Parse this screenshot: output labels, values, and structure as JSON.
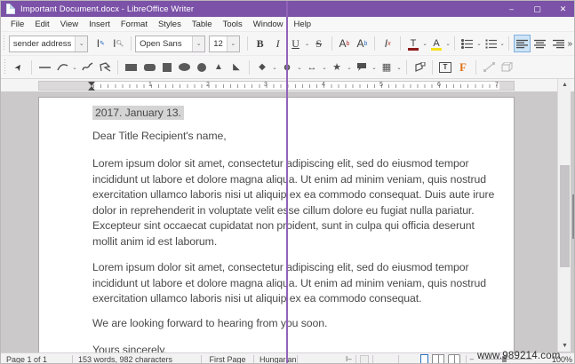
{
  "window": {
    "title": "Important Document.docx - LibreOffice Writer",
    "controls": {
      "minimize": "–",
      "maximize": "▢",
      "close": "✕"
    }
  },
  "menubar": {
    "items": [
      "File",
      "Edit",
      "View",
      "Insert",
      "Format",
      "Styles",
      "Table",
      "Tools",
      "Window",
      "Help"
    ]
  },
  "format_toolbar": {
    "paragraph_style": "sender address",
    "font_name": "Open Sans",
    "font_size": "12",
    "bold": "B",
    "italic": "I",
    "underline": "U",
    "strikethrough": "S",
    "superscript_base": "A",
    "superscript_mark": "b",
    "subscript_base": "A",
    "subscript_mark": "b",
    "clear_formatting": "I",
    "clear_mark": "x",
    "font_color_letter": "T",
    "highlight_letter": "A",
    "dropdown_glyph": "⌄",
    "overflow_glyph": "»"
  },
  "draw_toolbar": {
    "select_glyph": "➤",
    "triangle_glyph": "▲",
    "right_triangle_glyph": "◣",
    "diamond_glyph": "◆",
    "smiley_glyph": "☻",
    "block_arrow_glyph": "↔",
    "star_glyph": "★",
    "flowchart_glyph": "▦",
    "textbox_letter": "T",
    "fontwork_letter": "F",
    "dropdown_glyph": "⌄"
  },
  "ruler": {
    "numbers": [
      "1",
      "2",
      "3",
      "4",
      "5",
      "6",
      "7"
    ]
  },
  "document": {
    "date_field": "2017. January 13.",
    "salutation": "Dear Title Recipient's name,",
    "p1_lines": [
      "Lorem ipsum dolor sit amet, consectetur adipiscing elit, sed do eiusmod tempor",
      "incididunt ut labore et dolore magna aliqua. Ut enim ad minim veniam, quis nostrud",
      "exercitation ullamco laboris nisi ut aliquip ex ea commodo consequat. Duis aute irure",
      "dolor in reprehenderit in voluptate velit esse cillum dolore eu fugiat nulla pariatur.",
      "Excepteur sint occaecat cupidatat non proident, sunt in culpa qui officia deserunt",
      "mollit anim id est laborum."
    ],
    "p2_lines": [
      "Lorem ipsum dolor sit amet, consectetur adipiscing elit, sed do eiusmod tempor",
      "incididunt ut labore et dolore magna aliqua. Ut enim ad minim veniam, quis nostrud",
      "exercitation ullamco laboris nisi ut aliquip ex ea commodo consequat."
    ],
    "closing_line": "We are looking forward to hearing from you soon.",
    "signoff": "Yours sincerely,"
  },
  "statusbar": {
    "page_info": "Page 1 of 1",
    "word_count": "153 words, 982 characters",
    "page_style": "First Page",
    "language": "Hungarian",
    "insert_mode_glyph": "I–",
    "zoom_minus": "–",
    "zoom_level": "100%"
  },
  "scrollbar": {
    "up_glyph": "▲",
    "down_glyph": "▼"
  },
  "watermark": "www.989214.com",
  "colors": {
    "titlebar": "#7b52a7",
    "divider_line": "#9263b8",
    "selected_tool_bg": "#cde4f7",
    "font_color_bar": "#8f1c1c",
    "highlight_bar": "#f4e21a",
    "fontwork_orange": "#e0731d",
    "field_shading": "#d4d4d4"
  }
}
